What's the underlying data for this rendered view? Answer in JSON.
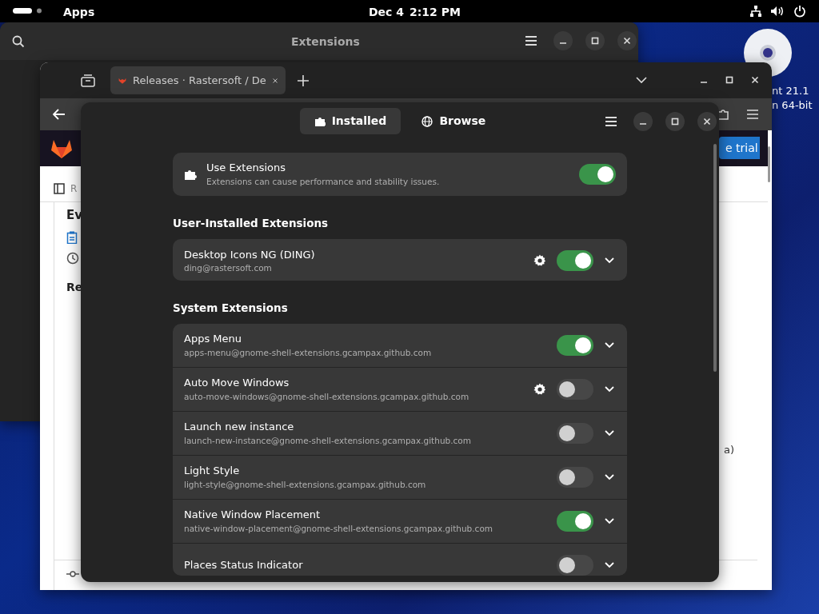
{
  "top_bar": {
    "title": "Apps",
    "date": "Dec 4",
    "time": "2:12 PM"
  },
  "desktop_icon": {
    "label_lines": [
      "nt 21.1",
      "n 64-bit"
    ]
  },
  "back_window": {
    "title": "Extensions"
  },
  "browser": {
    "tab": {
      "title": "Releases · Rastersoft / De",
      "selected": true
    },
    "page": {
      "trial_button": "e trial",
      "sidebar_label": "R",
      "heading": "Ev",
      "section_heading": "Re",
      "side_text": "a)"
    }
  },
  "extensions_window": {
    "tabs": [
      {
        "label": "Installed",
        "selected": true
      },
      {
        "label": "Browse",
        "selected": false
      }
    ],
    "master": {
      "title": "Use Extensions",
      "subtitle": "Extensions can cause performance and stability issues.",
      "on": true
    },
    "sections": [
      {
        "heading": "User-Installed Extensions",
        "items": [
          {
            "name": "Desktop Icons NG (DING)",
            "id": "ding@rastersoft.com",
            "on": true,
            "has_settings": true
          }
        ]
      },
      {
        "heading": "System Extensions",
        "items": [
          {
            "name": "Apps Menu",
            "id": "apps-menu@gnome-shell-extensions.gcampax.github.com",
            "on": true,
            "has_settings": false
          },
          {
            "name": "Auto Move Windows",
            "id": "auto-move-windows@gnome-shell-extensions.gcampax.github.com",
            "on": false,
            "has_settings": true
          },
          {
            "name": "Launch new instance",
            "id": "launch-new-instance@gnome-shell-extensions.gcampax.github.com",
            "on": false,
            "has_settings": false
          },
          {
            "name": "Light Style",
            "id": "light-style@gnome-shell-extensions.gcampax.github.com",
            "on": false,
            "has_settings": false
          },
          {
            "name": "Native Window Placement",
            "id": "native-window-placement@gnome-shell-extensions.gcampax.github.com",
            "on": true,
            "has_settings": false
          },
          {
            "name": "Places Status Indicator",
            "on": false,
            "has_settings": false
          }
        ]
      }
    ]
  }
}
